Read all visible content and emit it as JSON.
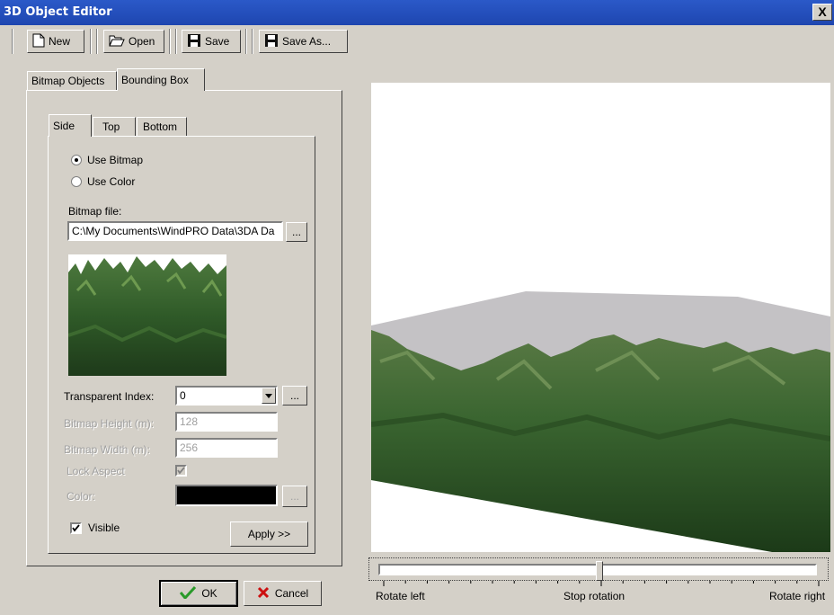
{
  "window": {
    "title": "3D Object Editor",
    "close_glyph": "X"
  },
  "toolbar": {
    "new_label": "New",
    "open_label": "Open",
    "save_label": "Save",
    "save_as_label": "Save As..."
  },
  "main_tabs": [
    "Bitmap Objects",
    "Bounding Box"
  ],
  "sub_tabs": [
    "Side",
    "Top",
    "Bottom"
  ],
  "options": {
    "use_bitmap": "Use Bitmap",
    "use_color": "Use Color",
    "selected": "Use Bitmap"
  },
  "bitmap": {
    "label": "Bitmap file:",
    "path": "C:\\My Documents\\WindPRO Data\\3DA Da",
    "browse": "..."
  },
  "fields": {
    "transparent_label": "Transparent Index:",
    "transparent_value": "0",
    "height_label": "Bitmap Height (m):",
    "height_value": "128",
    "width_label": "Bitmap Width (m):",
    "width_value": "256",
    "lock_label": "Lock Aspect",
    "color_label": "Color:",
    "color_value": "#000000",
    "more": "..."
  },
  "visible": {
    "label": "Visible",
    "checked": true
  },
  "buttons": {
    "apply": "Apply >>",
    "ok": "OK",
    "cancel": "Cancel"
  },
  "rotation": {
    "left": "Rotate left",
    "stop": "Stop rotation",
    "right": "Rotate right",
    "position": 0.5
  },
  "colors": {
    "titlebar": "#1e46b0",
    "face": "#d4d0c8",
    "ok_check": "#2a9a2a",
    "cancel_x": "#cc1010",
    "roof": "#c4c2c5"
  }
}
